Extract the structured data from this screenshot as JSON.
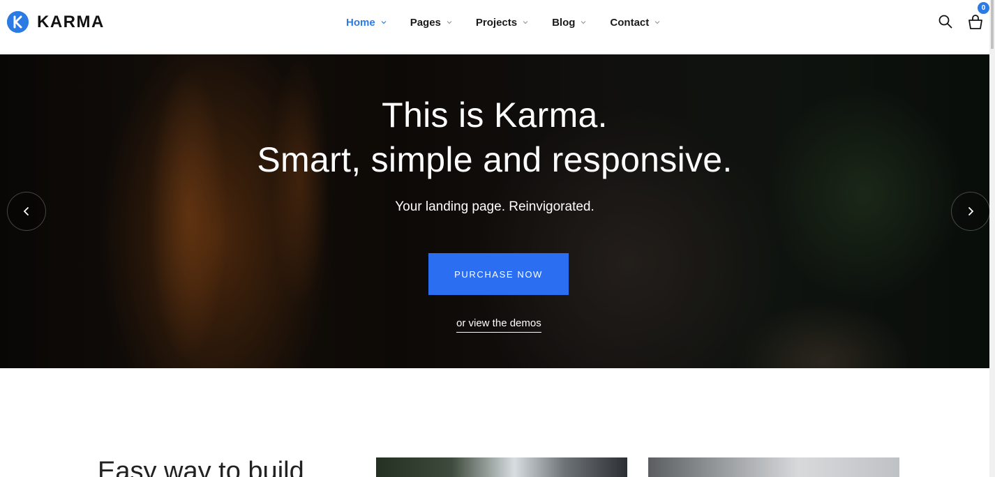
{
  "brand": {
    "name": "KARMA",
    "logo_letter": "K"
  },
  "nav": {
    "items": [
      {
        "label": "Home",
        "active": true
      },
      {
        "label": "Pages",
        "active": false
      },
      {
        "label": "Projects",
        "active": false
      },
      {
        "label": "Blog",
        "active": false
      },
      {
        "label": "Contact",
        "active": false
      }
    ]
  },
  "header": {
    "cart_count": "0",
    "search_icon": "search-icon",
    "cart_icon": "cart-icon"
  },
  "hero": {
    "title_line1": "This is Karma.",
    "title_line2": "Smart, simple and responsive.",
    "subtitle": "Your landing page. Reinvigorated.",
    "cta_label": "PURCHASE NOW",
    "secondary_link": "or view the demos"
  },
  "section": {
    "heading": "Easy way to build"
  },
  "colors": {
    "accent": "#2c7be5",
    "cta": "#2c6ef2",
    "text": "#1a1a1a"
  }
}
